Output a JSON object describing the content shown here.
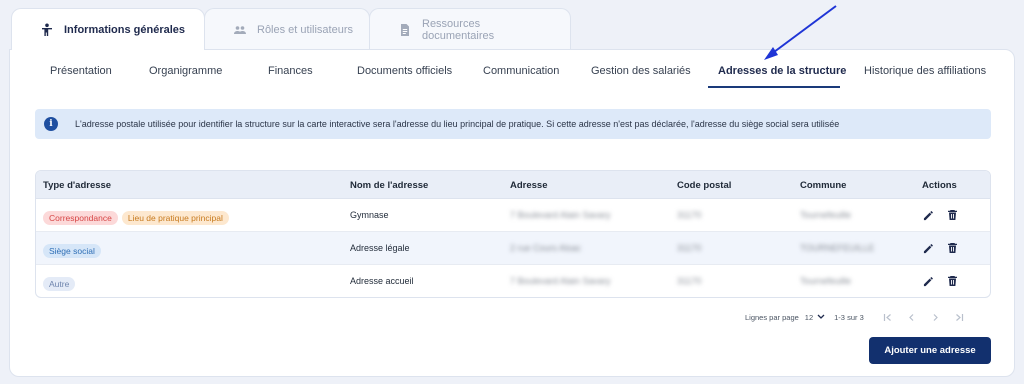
{
  "top_tabs": [
    {
      "label": "Informations générales",
      "icon": "person-icon",
      "active": true
    },
    {
      "label": "Rôles et utilisateurs",
      "icon": "group-icon",
      "active": false
    },
    {
      "label": "Ressources documentaires",
      "icon": "document-icon",
      "active": false
    }
  ],
  "sub_tabs": [
    {
      "label": "Présentation"
    },
    {
      "label": "Organigramme"
    },
    {
      "label": "Finances"
    },
    {
      "label": "Documents officiels"
    },
    {
      "label": "Communication"
    },
    {
      "label": "Gestion des salariés"
    },
    {
      "label": "Adresses de la structure",
      "active": true
    },
    {
      "label": "Historique des affiliations"
    }
  ],
  "info": {
    "icon": "info-icon",
    "text": "L'adresse postale utilisée pour identifier la structure sur la carte interactive sera l'adresse du lieu principal de pratique. Si cette adresse n'est pas déclarée, l'adresse du siège social sera utilisée"
  },
  "table": {
    "columns": [
      "Type d'adresse",
      "Nom de l'adresse",
      "Adresse",
      "Code postal",
      "Commune",
      "Actions"
    ],
    "rows": [
      {
        "types": [
          {
            "label": "Correspondance",
            "bg": "#fcd9d9",
            "fg": "#d64545"
          },
          {
            "label": "Lieu de pratique principal",
            "bg": "#fde8cf",
            "fg": "#c77a1e"
          }
        ],
        "name": "Gymnase",
        "address": "7 Boulevard Alain Savary",
        "postal": "31170",
        "city": "Tournefeuille"
      },
      {
        "types": [
          {
            "label": "Siège social",
            "bg": "#d6e6f8",
            "fg": "#2f6fb6"
          }
        ],
        "name": "Adresse légale",
        "address": "2 rue Cours Alsac",
        "postal": "31170",
        "city": "TOURNEFEUILLE"
      },
      {
        "types": [
          {
            "label": "Autre",
            "bg": "#e4ebf7",
            "fg": "#6f85ad"
          }
        ],
        "name": "Adresse accueil",
        "address": "7 Boulevard Alain Savary",
        "postal": "31170",
        "city": "Tournefeuille"
      }
    ]
  },
  "pagination": {
    "rows_per_page_label": "Lignes par page",
    "rows_per_page_value": "12",
    "range": "1-3 sur 3"
  },
  "add_button": "Ajouter une adresse",
  "colors": {
    "primary": "#12306e",
    "arrow": "#1f35d6",
    "info_bg": "#dde9f9"
  }
}
